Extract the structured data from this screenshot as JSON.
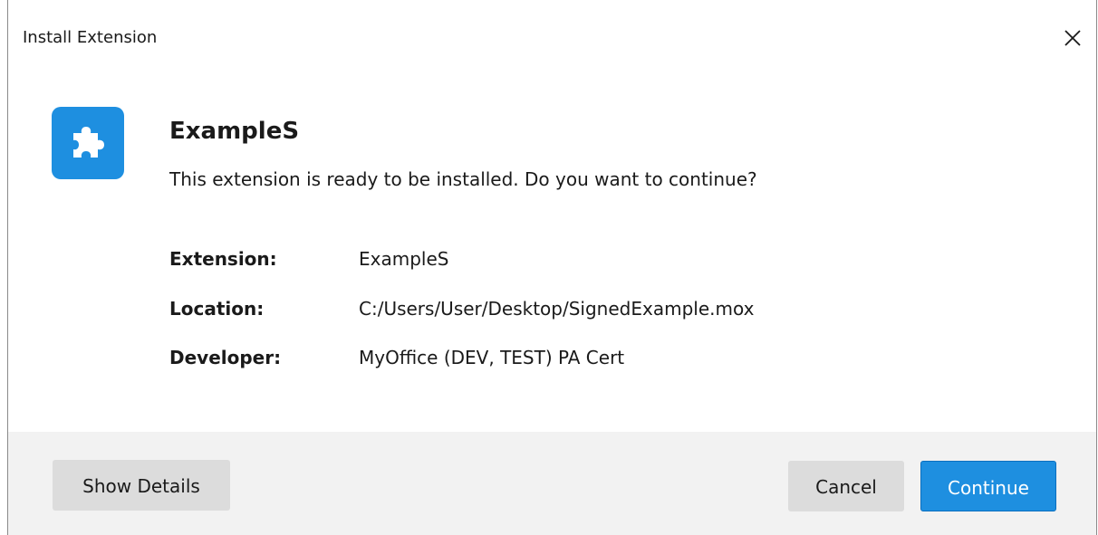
{
  "window": {
    "title": "Install Extension",
    "close_icon": "close-icon"
  },
  "extension": {
    "icon": "puzzle-icon",
    "icon_color": "#1e8fe0",
    "name": "ExampleS",
    "message": "This extension is ready to be installed. Do you want to continue?"
  },
  "details": [
    {
      "label": "Extension:",
      "value": "ExampleS"
    },
    {
      "label": "Location:",
      "value": "C:/Users/User/Desktop/SignedExample.mox"
    },
    {
      "label": "Developer:",
      "value": "MyOffice (DEV, TEST) PA Cert"
    }
  ],
  "footer": {
    "show_details_label": "Show Details",
    "cancel_label": "Cancel",
    "continue_label": "Continue",
    "accent_color": "#1e8fe0"
  }
}
